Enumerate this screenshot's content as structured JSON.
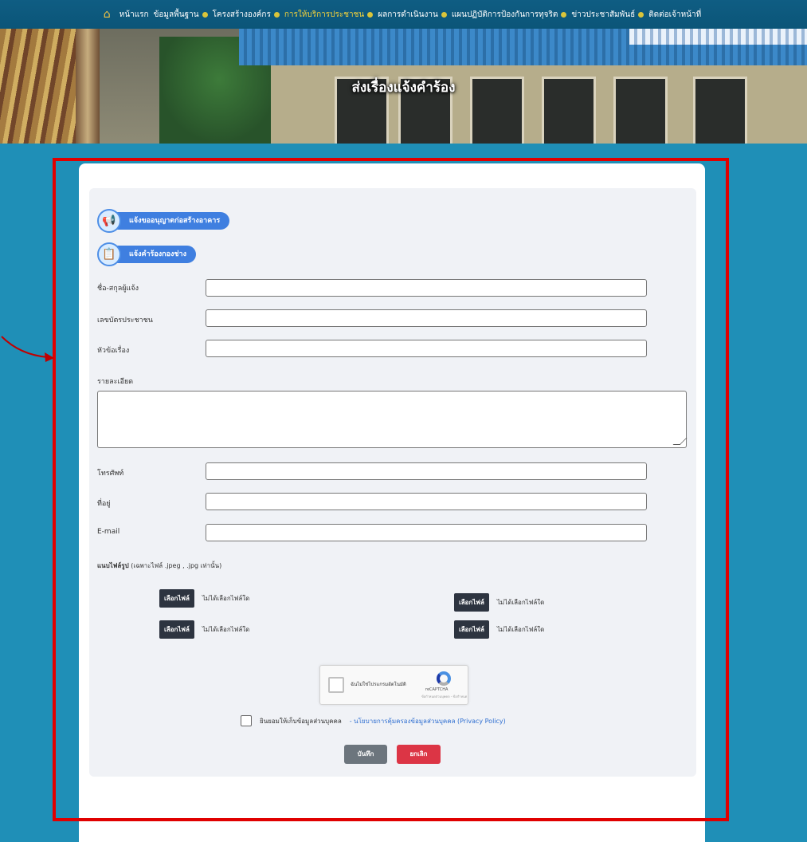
{
  "nav": {
    "home_icon": "home-icon",
    "items": [
      {
        "label": "หน้าแรก"
      },
      {
        "label": "ข้อมูลพื้นฐาน"
      },
      {
        "label": "โครงสร้างองค์กร"
      },
      {
        "label": "การให้บริการประชาชน"
      },
      {
        "label": "ผลการดำเนินงาน"
      },
      {
        "label": "แผนปฏิบัติการป้องกันการทุจริต"
      },
      {
        "label": "ข่าวประชาสัมพันธ์"
      },
      {
        "label": "ติดต่อเจ้าหน้าที่"
      }
    ],
    "active_index": 3,
    "active_color": "#f5d33a"
  },
  "hero": {
    "title": "ส่งเรื่องแจ้งคำร้อง"
  },
  "form": {
    "option1_label": "แจ้งขออนุญาตก่อสร้างอาคาร",
    "option1_icon": "megaphone-icon",
    "option2_label": "แจ้งคำร้องกองช่าง",
    "option2_icon": "clipboard-icon",
    "name_label": "ชื่อ-สกุลผู้แจ้ง",
    "idcard_label": "เลขบัตรประชาชน",
    "subject_label": "หัวข้อเรื่อง",
    "detail_label": "รายละเอียด",
    "phone_label": "โทรศัพท์",
    "address_label": "ที่อยู่",
    "email_label": "E-mail",
    "upload_title": "แนบไฟล์รูป",
    "upload_note": " (เฉพาะไฟล์ .jpeg , .jpg เท่านั้น)",
    "file_button": "เลือกไฟล์",
    "file_status": "ไม่ได้เลือกไฟล์ใด",
    "captcha_text": "ฉันไม่ใช่โปรแกรมอัตโนมัติ",
    "captcha_brand": "reCAPTCHA",
    "captcha_terms": "ข้อกำหนดส่วนบุคคล - ข้อกำหนด",
    "consent_text": "ยินยอมให้เก็บข้อมูลส่วนบุคคล",
    "policy_link": "- นโยบายการคุ้มครองข้อมูลส่วนบุคคล (Privacy Policy)",
    "save_label": "บันทึก",
    "cancel_label": "ยกเลิก"
  },
  "colors": {
    "background": "#1f8fb7",
    "pill": "#3f7fe0",
    "highlight_box": "#e00000",
    "save": "#6c757d",
    "cancel": "#dc3545"
  }
}
